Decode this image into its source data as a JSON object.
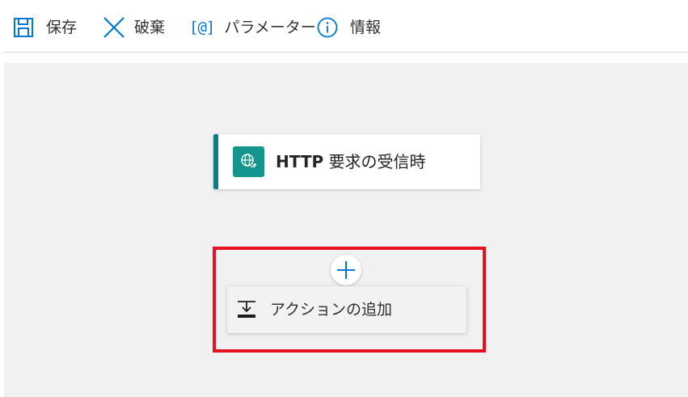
{
  "toolbar": {
    "save_label": "保存",
    "discard_label": "破棄",
    "parameters_label": "パラメーター",
    "info_label": "情報",
    "parameters_icon_text": "[@]"
  },
  "trigger": {
    "title_prefix": "HTTP",
    "title_rest": " 要求の受信時",
    "accent_color": "#0e7d86",
    "icon_color": "#14968f"
  },
  "add_action": {
    "label": "アクションの追加"
  },
  "highlight": {
    "color": "#e81123"
  },
  "colors": {
    "accent_blue": "#0078d4",
    "canvas_bg": "#f1f1f1"
  }
}
